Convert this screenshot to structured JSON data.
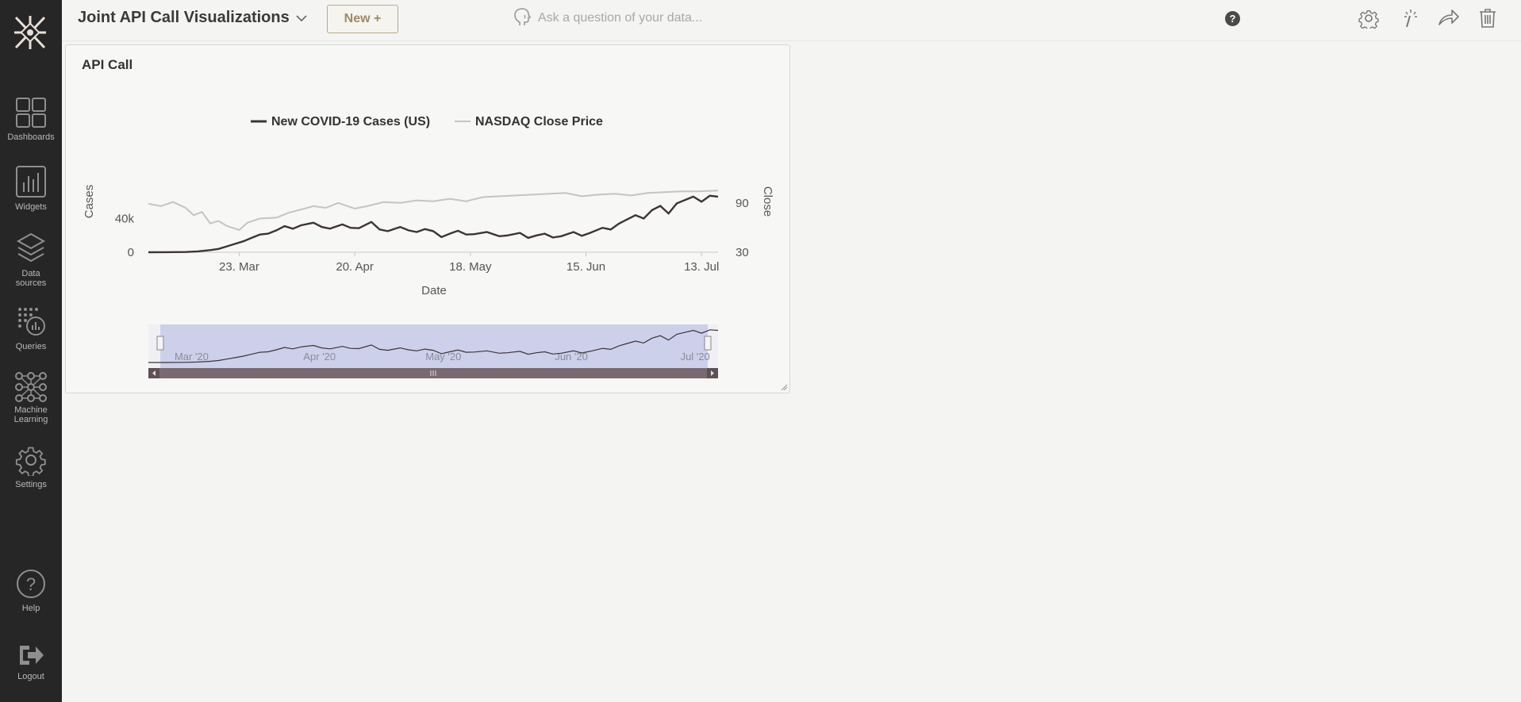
{
  "app": {
    "dashboard_title": "Joint API Call Visualizations",
    "new_button": "New +",
    "ask_placeholder": "Ask a question of your data...",
    "help_glyph": "?"
  },
  "sidebar": {
    "items": [
      {
        "label": "Dashboards",
        "icon": "dashboard-grid-icon"
      },
      {
        "label": "Widgets",
        "icon": "bar-chart-icon"
      },
      {
        "label": "Data sources",
        "icon": "layers-icon"
      },
      {
        "label": "Queries",
        "icon": "query-icon"
      },
      {
        "label": "Machine Learning",
        "icon": "network-icon"
      },
      {
        "label": "Settings",
        "icon": "gear-icon"
      },
      {
        "label": "Help",
        "icon": "help-circle-icon"
      },
      {
        "label": "Logout",
        "icon": "logout-icon"
      }
    ]
  },
  "toolbar": {
    "icons": [
      "gear-icon",
      "magic-wand-icon",
      "share-arrow-icon",
      "trash-icon"
    ]
  },
  "widget": {
    "title": "API Call"
  },
  "colors": {
    "sidebar_bg": "#262626",
    "series_cases": "#3d3437",
    "series_nasdaq": "#c4c4c8",
    "navigator_fill": "#cdd0ea",
    "scrollbar": "#7a6a70"
  },
  "chart_data": {
    "type": "line",
    "legend": [
      "New COVID-19 Cases (US)",
      "NASDAQ Close Price"
    ],
    "legend_position": "top-center",
    "x_axis": {
      "label": "Date",
      "ticks": [
        "23. Mar",
        "20. Apr",
        "18. May",
        "15. Jun",
        "13. Jul"
      ]
    },
    "y_axis_left": {
      "label": "Cases",
      "ticks": [
        "0",
        "40k"
      ],
      "range": [
        0,
        80000
      ]
    },
    "y_axis_right": {
      "label": "Close",
      "ticks": [
        "30",
        "90"
      ],
      "range": [
        30,
        110
      ]
    },
    "grid": false,
    "x_start": "2020-03-01",
    "x_end": "2020-07-17",
    "series": [
      {
        "name": "New COVID-19 Cases (US)",
        "axis": "left",
        "points": [
          [
            "2020-03-01",
            0
          ],
          [
            "2020-03-05",
            50
          ],
          [
            "2020-03-10",
            300
          ],
          [
            "2020-03-13",
            1000
          ],
          [
            "2020-03-16",
            2500
          ],
          [
            "2020-03-18",
            4000
          ],
          [
            "2020-03-20",
            7000
          ],
          [
            "2020-03-22",
            10000
          ],
          [
            "2020-03-24",
            13000
          ],
          [
            "2020-03-26",
            17000
          ],
          [
            "2020-03-28",
            21000
          ],
          [
            "2020-03-30",
            22000
          ],
          [
            "2020-04-01",
            26000
          ],
          [
            "2020-04-03",
            31000
          ],
          [
            "2020-04-05",
            28000
          ],
          [
            "2020-04-07",
            32000
          ],
          [
            "2020-04-10",
            35000
          ],
          [
            "2020-04-12",
            30000
          ],
          [
            "2020-04-14",
            28000
          ],
          [
            "2020-04-17",
            33000
          ],
          [
            "2020-04-19",
            29000
          ],
          [
            "2020-04-21",
            28500
          ],
          [
            "2020-04-24",
            36000
          ],
          [
            "2020-04-26",
            27000
          ],
          [
            "2020-04-28",
            25000
          ],
          [
            "2020-05-01",
            30000
          ],
          [
            "2020-05-03",
            26000
          ],
          [
            "2020-05-05",
            24000
          ],
          [
            "2020-05-07",
            27500
          ],
          [
            "2020-05-09",
            25000
          ],
          [
            "2020-05-11",
            18000
          ],
          [
            "2020-05-13",
            22000
          ],
          [
            "2020-05-15",
            25500
          ],
          [
            "2020-05-17",
            21000
          ],
          [
            "2020-05-19",
            21500
          ],
          [
            "2020-05-22",
            24000
          ],
          [
            "2020-05-25",
            19000
          ],
          [
            "2020-05-27",
            20000
          ],
          [
            "2020-05-30",
            23000
          ],
          [
            "2020-06-01",
            17000
          ],
          [
            "2020-06-03",
            20000
          ],
          [
            "2020-06-05",
            22000
          ],
          [
            "2020-06-07",
            17500
          ],
          [
            "2020-06-09",
            19000
          ],
          [
            "2020-06-12",
            24000
          ],
          [
            "2020-06-14",
            19500
          ],
          [
            "2020-06-16",
            23000
          ],
          [
            "2020-06-19",
            29000
          ],
          [
            "2020-06-21",
            27000
          ],
          [
            "2020-06-23",
            34000
          ],
          [
            "2020-06-25",
            39000
          ],
          [
            "2020-06-27",
            44000
          ],
          [
            "2020-06-29",
            40000
          ],
          [
            "2020-07-01",
            50000
          ],
          [
            "2020-07-03",
            55000
          ],
          [
            "2020-07-05",
            46000
          ],
          [
            "2020-07-07",
            58000
          ],
          [
            "2020-07-09",
            62000
          ],
          [
            "2020-07-11",
            66000
          ],
          [
            "2020-07-13",
            60000
          ],
          [
            "2020-07-15",
            67000
          ],
          [
            "2020-07-17",
            66000
          ]
        ]
      },
      {
        "name": "NASDAQ Close Price",
        "axis": "right",
        "points": [
          [
            "2020-03-01",
            89
          ],
          [
            "2020-03-04",
            86
          ],
          [
            "2020-03-07",
            91
          ],
          [
            "2020-03-10",
            84
          ],
          [
            "2020-03-12",
            75
          ],
          [
            "2020-03-14",
            79
          ],
          [
            "2020-03-16",
            65
          ],
          [
            "2020-03-18",
            68
          ],
          [
            "2020-03-20",
            62
          ],
          [
            "2020-03-23",
            57
          ],
          [
            "2020-03-25",
            66
          ],
          [
            "2020-03-28",
            71
          ],
          [
            "2020-04-01",
            72
          ],
          [
            "2020-04-04",
            78
          ],
          [
            "2020-04-07",
            82
          ],
          [
            "2020-04-10",
            86
          ],
          [
            "2020-04-13",
            84
          ],
          [
            "2020-04-16",
            90
          ],
          [
            "2020-04-20",
            83
          ],
          [
            "2020-04-23",
            86
          ],
          [
            "2020-04-27",
            91
          ],
          [
            "2020-05-01",
            90
          ],
          [
            "2020-05-05",
            93
          ],
          [
            "2020-05-09",
            92
          ],
          [
            "2020-05-13",
            95
          ],
          [
            "2020-05-17",
            92
          ],
          [
            "2020-05-21",
            97
          ],
          [
            "2020-05-25",
            98
          ],
          [
            "2020-05-29",
            99
          ],
          [
            "2020-06-02",
            100
          ],
          [
            "2020-06-06",
            101
          ],
          [
            "2020-06-10",
            102
          ],
          [
            "2020-06-14",
            98
          ],
          [
            "2020-06-18",
            100
          ],
          [
            "2020-06-22",
            101
          ],
          [
            "2020-06-26",
            99
          ],
          [
            "2020-06-30",
            102
          ],
          [
            "2020-07-04",
            103
          ],
          [
            "2020-07-08",
            104
          ],
          [
            "2020-07-12",
            104
          ],
          [
            "2020-07-17",
            105
          ]
        ]
      }
    ],
    "navigator": {
      "labels": [
        "Mar '20",
        "Apr '20",
        "May '20",
        "Jun '20",
        "Jul '20"
      ],
      "selected_range": [
        "2020-03-01",
        "2020-07-17"
      ]
    }
  }
}
